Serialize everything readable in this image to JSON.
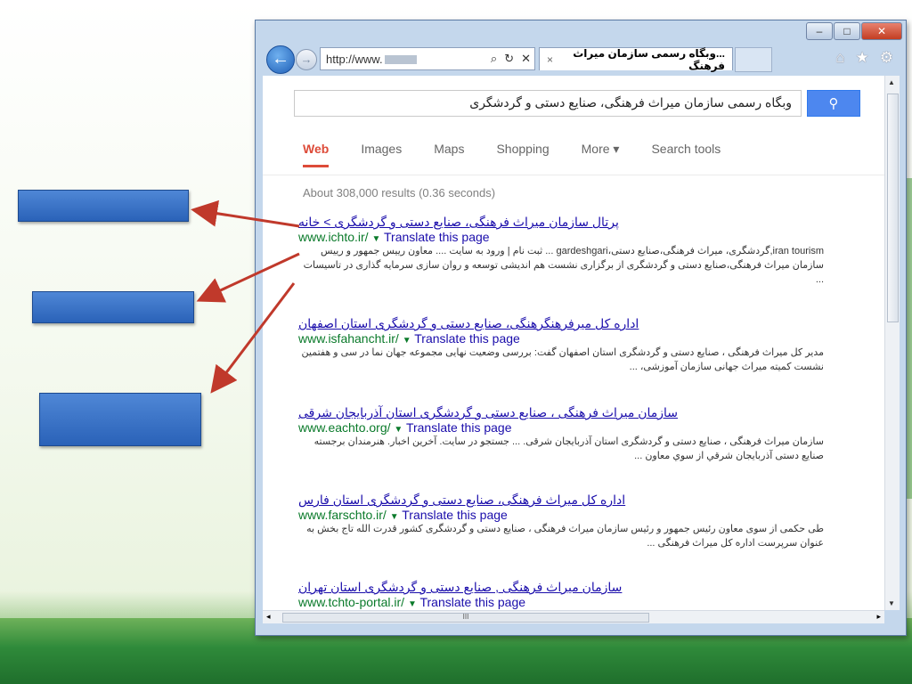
{
  "colors": {
    "accent_green": "#2f8a3a",
    "callout_blue": "#2a62b8",
    "arrow_red": "#c0392b",
    "link_blue": "#1a0dab",
    "url_green": "#0a7a2a",
    "google_red": "#dd4b39"
  },
  "browser": {
    "address_text": "http://www.",
    "tab_title": "...وبگاه رسمی سازمان میراث فرهنگ",
    "tab_close": "×",
    "controls": {
      "minimize": "–",
      "maximize": "□",
      "close": "✕"
    },
    "icons": [
      "back-icon",
      "forward-icon",
      "search-icon",
      "refresh-icon",
      "stop-icon",
      "home-icon",
      "favorites-icon",
      "settings-icon"
    ]
  },
  "google": {
    "query": "وبگاه رسمی سازمان میراث فرهنگی، صنایع دستی و گردشگری",
    "tabs": [
      "Web",
      "Images",
      "Maps",
      "Shopping",
      "More ▾",
      "Search tools"
    ],
    "stats": "About 308,000 results (0.36 seconds)"
  },
  "results": [
    {
      "title": "پرتال سازمان میراث فرهنگی، صنایع دستی و گردشگری > خانه",
      "url": "www.ichto.ir/",
      "translate": "Translate this page",
      "snippet": "iran tourism,گردشگری، میراث فرهنگی،صنایع دستی،gardeshgari ... ثبت نام | ورود به سایت .... معاون رییس جمهور و رییس سازمان میراث فرهنگی،صنایع دستی و گردشگری از برگزاری نشست هم اندیشی توسعه و روان سازی سرمایه گذاری در تاسیسات ..."
    },
    {
      "title": "اداره کل میرفرهنگرهنگی، صنایع دستی و گردشگری استان اصفهان",
      "url": "www.isfahancht.ir/",
      "translate": "Translate this page",
      "snippet": "مدیر کل میراث فرهنگی ، صنایع دستی و گردشگری استان اصفهان گفت: بررسی وضعیت نهایی مجموعه جهان نما در سی و هفتمین نشست کمیته میراث جهانی سازمان آموزشی، ..."
    },
    {
      "title": "سازمان میراث فرهنگی ، صنایع دستی و گردشگری استان آذربایجان شرقی",
      "url": "www.eachto.org/",
      "translate": "Translate this page",
      "snippet": "سازمان میراث فرهنگی ، صنایع دستی و گردشگری استان آذربایجان شرقی. ... جستجو در سایت. آخرین اخبار. هنرمندان برجسته صنایع دستی آذربایجان شرقي از سوي معاون ..."
    },
    {
      "title": "اداره کل میراث فرهنگی، صنایع دستی و گردشگری استان فارس",
      "url": "www.farschto.ir/",
      "translate": "Translate this page",
      "snippet": "طی حکمی از سوی معاون رئیس جمهور و رئیس سازمان میراث فرهنگی ، صنایع دستی و گردشگری کشور قدرت الله تاج بخش به عنوان سرپرست اداره کل میراث فرهنگی ..."
    },
    {
      "title": "سازمان میراث فرهنگی , صنایع دستی و گردشگری استان تهران",
      "url": "www.tchto-portal.ir/",
      "translate": "Translate this page",
      "snippet": ""
    }
  ],
  "scrollbar": {
    "h_thumb_label": "III"
  },
  "slide": {
    "page_number": ""
  }
}
